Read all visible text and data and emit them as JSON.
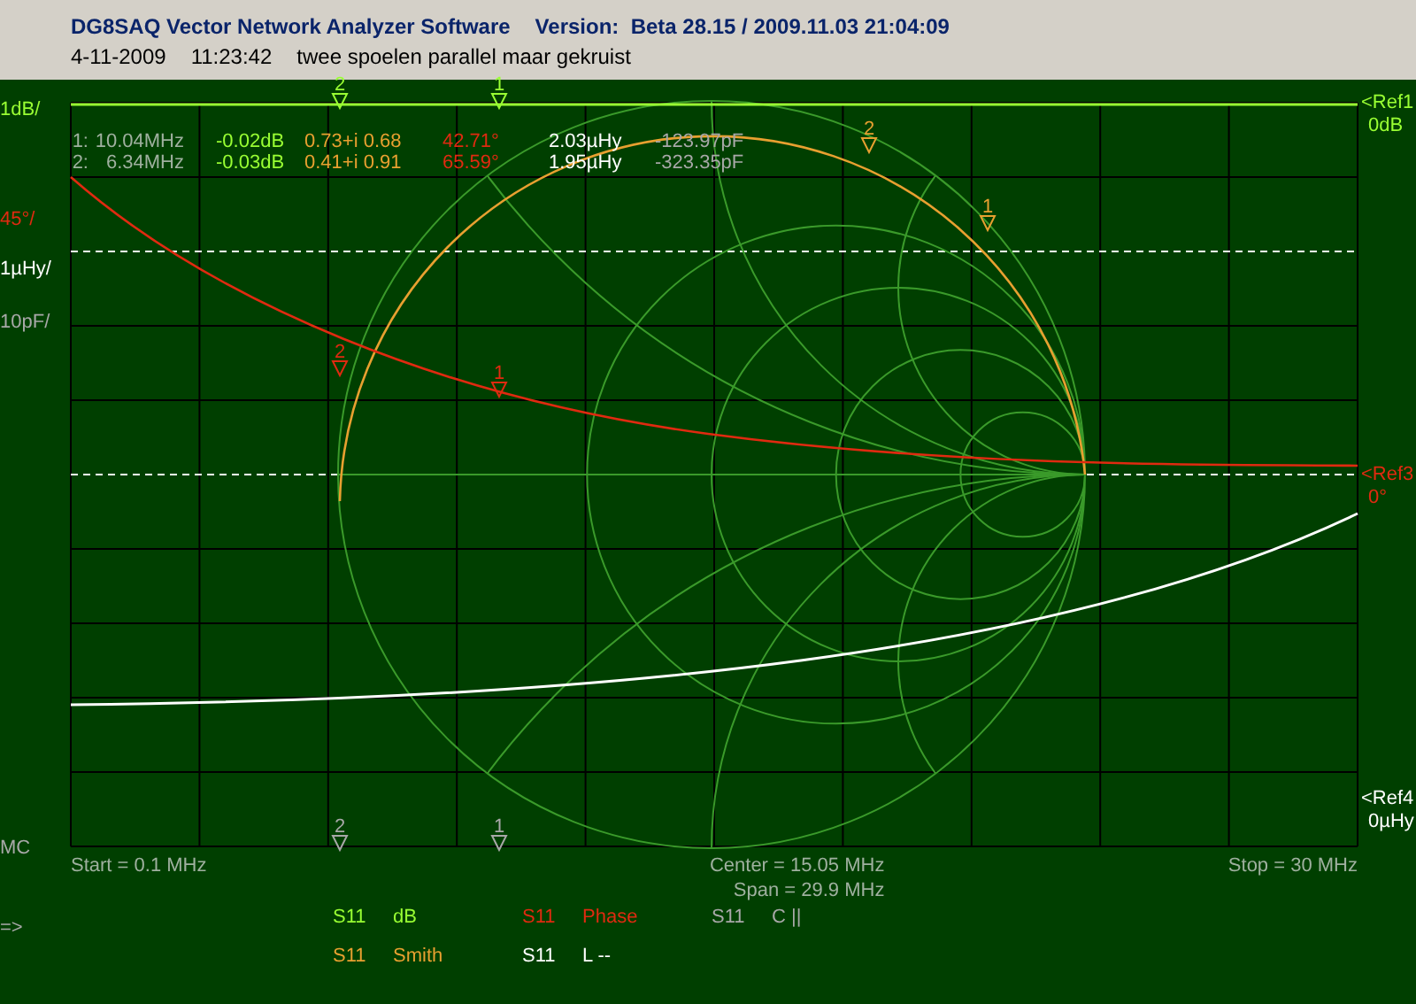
{
  "header": {
    "title": "DG8SAQ Vector Network Analyzer Software",
    "version": "Version:  Beta 28.15 / 2009.11.03 21:04:09",
    "date": "4-11-2009",
    "time": "11:23:42",
    "note": "twee spoelen parallel maar gekruist"
  },
  "left_labels": [
    {
      "text": "1dB/",
      "color": "#99ff33"
    },
    {
      "text": "45°/",
      "color": "#e02a10"
    },
    {
      "text": "1µHy/",
      "color": "#ffffff"
    },
    {
      "text": "10pF/",
      "color": "#a8a8a8"
    },
    {
      "text": "MC",
      "color": "#a8a8a8"
    },
    {
      "text": "=>",
      "color": "#a8a8a8"
    }
  ],
  "right_labels": [
    {
      "ref": "<Ref1",
      "value": "0dB",
      "color": "#99ff33"
    },
    {
      "ref": "<Ref3",
      "value": "0°",
      "color": "#e02a10"
    },
    {
      "ref": "<Ref4",
      "value": "0µHy",
      "color": "#ffffff"
    }
  ],
  "readouts": [
    {
      "label": "1:",
      "frequency": "10.04MHz",
      "db": "-0.02dB",
      "smith": "0.73+i 0.68",
      "phase": "42.71°",
      "inductance": "2.03µHy",
      "capacitance": "-123.97pF"
    },
    {
      "label": "2:",
      "frequency": "6.34MHz",
      "db": "-0.03dB",
      "smith": "0.41+i 0.91",
      "phase": "65.59°",
      "inductance": "1.95µHy",
      "capacitance": "-323.35pF"
    }
  ],
  "marker_flags": [
    {
      "text": "2"
    },
    {
      "text": "1"
    },
    {
      "text": "2"
    },
    {
      "text": "1"
    },
    {
      "text": "2"
    },
    {
      "text": "1"
    },
    {
      "text": "2"
    },
    {
      "text": "1"
    }
  ],
  "sweep": {
    "start": "Start = 0.1 MHz",
    "center": "Center = 15.05 MHz",
    "span": "Span = 29.9 MHz",
    "stop": "Stop = 30 MHz"
  },
  "traces": [
    {
      "param": "S11",
      "format": "dB",
      "color": "#99ff33"
    },
    {
      "param": "S11",
      "format": "Phase",
      "color": "#e02a10"
    },
    {
      "param": "S11",
      "format": "C ||",
      "color": "#a8a8a8"
    },
    {
      "param": "S11",
      "format": "Smith",
      "color": "#e8a030"
    },
    {
      "param": "S11",
      "format": "L --",
      "color": "#ffffff"
    }
  ]
}
